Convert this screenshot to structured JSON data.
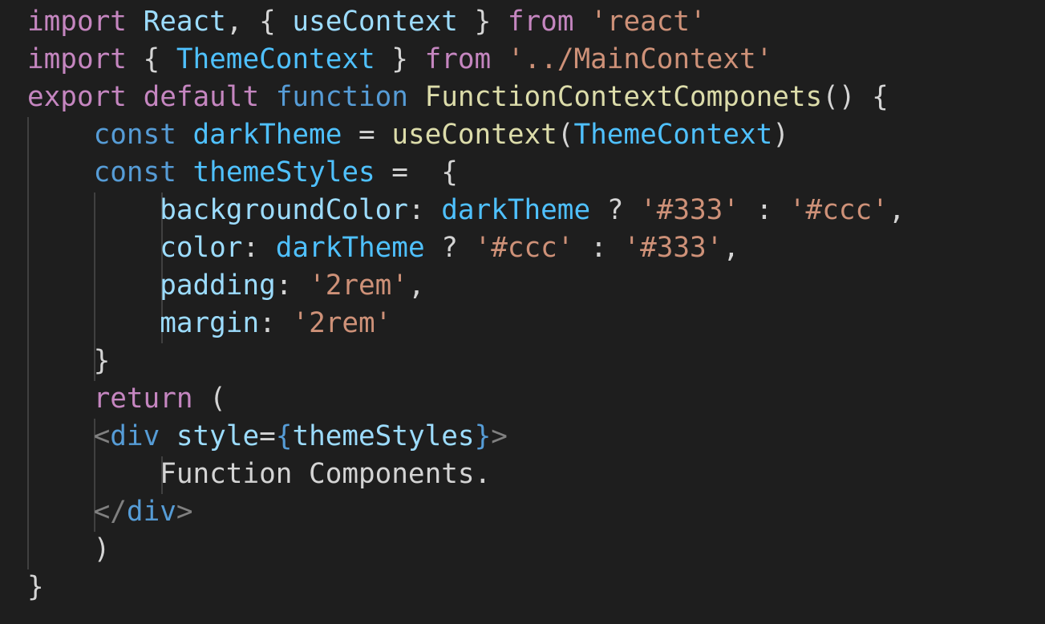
{
  "theme": {
    "background": "#1e1e1e",
    "indent_guide": "#404040",
    "colors": {
      "kw": "#c586c0",
      "storage": "#569cd6",
      "var": "#9cdcfe",
      "cls": "#4fc1ff",
      "fn": "#dcdcaa",
      "str": "#ce9178",
      "punc": "#d4d4d4",
      "tag": "#808080",
      "text": "#d4d4d4"
    }
  },
  "code": {
    "lines": [
      [
        [
          "kw",
          "import"
        ],
        [
          "punc",
          " "
        ],
        [
          "var",
          "React"
        ],
        [
          "punc",
          ", { "
        ],
        [
          "var",
          "useContext"
        ],
        [
          "punc",
          " } "
        ],
        [
          "kw",
          "from"
        ],
        [
          "punc",
          " "
        ],
        [
          "str",
          "'react'"
        ]
      ],
      [
        [
          "kw",
          "import"
        ],
        [
          "punc",
          " { "
        ],
        [
          "cls",
          "ThemeContext"
        ],
        [
          "punc",
          " } "
        ],
        [
          "kw",
          "from"
        ],
        [
          "punc",
          " "
        ],
        [
          "str",
          "'../MainContext'"
        ]
      ],
      [
        [
          "kw",
          "export"
        ],
        [
          "punc",
          " "
        ],
        [
          "kw",
          "default"
        ],
        [
          "punc",
          " "
        ],
        [
          "storage",
          "function"
        ],
        [
          "punc",
          " "
        ],
        [
          "fn",
          "FunctionContextComponets"
        ],
        [
          "punc",
          "() {"
        ]
      ],
      [
        [
          "punc",
          "    "
        ],
        [
          "storage",
          "const"
        ],
        [
          "punc",
          " "
        ],
        [
          "cls",
          "darkTheme"
        ],
        [
          "punc",
          " = "
        ],
        [
          "fn",
          "useContext"
        ],
        [
          "punc",
          "("
        ],
        [
          "cls",
          "ThemeContext"
        ],
        [
          "punc",
          ")"
        ]
      ],
      [
        [
          "punc",
          "    "
        ],
        [
          "storage",
          "const"
        ],
        [
          "punc",
          " "
        ],
        [
          "cls",
          "themeStyles"
        ],
        [
          "punc",
          " =  {"
        ]
      ],
      [
        [
          "punc",
          "        "
        ],
        [
          "var",
          "backgroundColor"
        ],
        [
          "punc",
          ": "
        ],
        [
          "cls",
          "darkTheme"
        ],
        [
          "punc",
          " ? "
        ],
        [
          "str",
          "'#333'"
        ],
        [
          "punc",
          " : "
        ],
        [
          "str",
          "'#ccc'"
        ],
        [
          "punc",
          ","
        ]
      ],
      [
        [
          "punc",
          "        "
        ],
        [
          "var",
          "color"
        ],
        [
          "punc",
          ": "
        ],
        [
          "cls",
          "darkTheme"
        ],
        [
          "punc",
          " ? "
        ],
        [
          "str",
          "'#ccc'"
        ],
        [
          "punc",
          " : "
        ],
        [
          "str",
          "'#333'"
        ],
        [
          "punc",
          ","
        ]
      ],
      [
        [
          "punc",
          "        "
        ],
        [
          "var",
          "padding"
        ],
        [
          "punc",
          ": "
        ],
        [
          "str",
          "'2rem'"
        ],
        [
          "punc",
          ","
        ]
      ],
      [
        [
          "punc",
          "        "
        ],
        [
          "var",
          "margin"
        ],
        [
          "punc",
          ": "
        ],
        [
          "str",
          "'2rem'"
        ]
      ],
      [
        [
          "punc",
          "    }"
        ]
      ],
      [
        [
          "punc",
          "    "
        ],
        [
          "kw",
          "return"
        ],
        [
          "punc",
          " ("
        ]
      ],
      [
        [
          "punc",
          "    "
        ],
        [
          "tag",
          "<"
        ],
        [
          "storage",
          "div"
        ],
        [
          "punc",
          " "
        ],
        [
          "var",
          "style"
        ],
        [
          "punc",
          "="
        ],
        [
          "storage",
          "{"
        ],
        [
          "var",
          "themeStyles"
        ],
        [
          "storage",
          "}"
        ],
        [
          "tag",
          ">"
        ]
      ],
      [
        [
          "punc",
          "        "
        ],
        [
          "text",
          "Function Components."
        ]
      ],
      [
        [
          "punc",
          "    "
        ],
        [
          "tag",
          "</"
        ],
        [
          "storage",
          "div"
        ],
        [
          "tag",
          ">"
        ]
      ],
      [
        [
          "punc",
          "    )"
        ]
      ],
      [
        [
          "punc",
          "}"
        ]
      ]
    ]
  }
}
